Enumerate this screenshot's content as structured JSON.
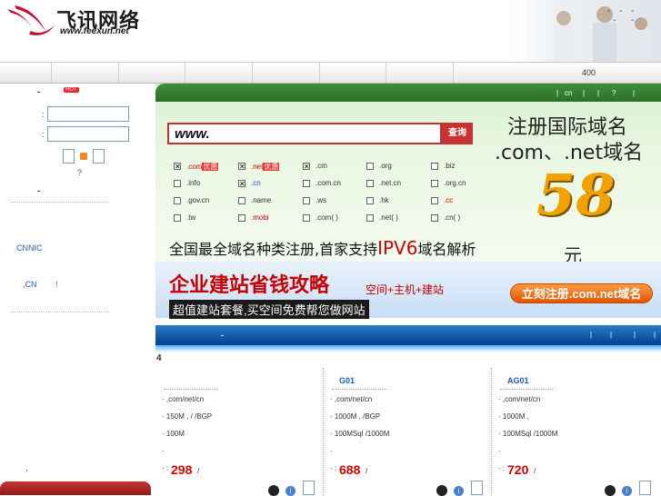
{
  "logo": {
    "name_cn": "飞讯网络",
    "url": "www.feexun.net"
  },
  "nav": {
    "phone_prefix": "400"
  },
  "sidebar": {
    "hot_label": "HOT",
    "field1_colon": ":",
    "field2_colon": ":",
    "help_mark": "?",
    "cnnic": "CNNIC",
    "cn_notice": ",CN",
    "exclaim": "!",
    "dash1": "-",
    "dash2": "-",
    "comma": ","
  },
  "banner": {
    "top_links": [
      "cn",
      "?"
    ],
    "search_prefix": "www.",
    "search_button": "查询",
    "domains": [
      {
        "label": ".com",
        "hot": "优惠",
        "checked": true,
        "red": true
      },
      {
        "label": ".net",
        "hot": "优惠",
        "checked": true,
        "red": true
      },
      {
        "label": ".cm",
        "checked": true
      },
      {
        "label": ".org",
        "checked": false
      },
      {
        "label": ".biz",
        "checked": false
      },
      {
        "label": ".info",
        "checked": false
      },
      {
        "label": ".cn",
        "checked": true,
        "blue": true
      },
      {
        "label": ".com.cn",
        "checked": false
      },
      {
        "label": ".net.cn",
        "checked": false
      },
      {
        "label": ".org.cn",
        "checked": false
      },
      {
        "label": ".gov.cn",
        "checked": false
      },
      {
        "label": ".name",
        "checked": false
      },
      {
        "label": ".ws",
        "checked": false
      },
      {
        "label": ".hk",
        "checked": false
      },
      {
        "label": ".cc",
        "checked": false,
        "red": true
      },
      {
        "label": ".tw",
        "checked": false
      },
      {
        "label": ".mobi",
        "checked": false,
        "red": true
      },
      {
        "label": ".com( )",
        "checked": false
      },
      {
        "label": ".net( )",
        "checked": false
      },
      {
        "label": ".cn( )",
        "checked": false
      }
    ],
    "promo_line1": "注册国际域名",
    "promo_line2": ".com、.net域名",
    "price": "58",
    "unit": "元",
    "slogan_a": "全国最全域名种类注册,首家支持",
    "slogan_ipv6": "IPV6",
    "slogan_b": "域名解析"
  },
  "ad2": {
    "title": "企业建站省钱攻略",
    "subtitle": "空间+主机+建站",
    "band": "超值建站套餐,买空间免费帮您做网站",
    "button": "立刻注册.com.net域名"
  },
  "bluebar": {
    "dash": "-",
    "number": "4"
  },
  "products": [
    {
      "name": "",
      "lines": [
        ",com/net/cn",
        "150M ,  / /BGP",
        "100M",
        "",
        ":"
      ],
      "price": "298",
      "slash": "/"
    },
    {
      "name": "G01",
      "lines": [
        ",com/net/cn",
        "1000M ,  /BGP",
        "100MSql  /1000M",
        "",
        ":"
      ],
      "price": "688",
      "slash": "/"
    },
    {
      "name": "AG01",
      "lines": [
        ",com/net/cn",
        "1000M  ,",
        "100MSql  /1000M",
        "",
        ":"
      ],
      "price": "720",
      "slash": "/"
    }
  ],
  "colors": {
    "accent_red": "#c83232",
    "banner_green": "#2f6f2c",
    "blue_bar": "#0b4d9a",
    "price_gold": "#f2a200"
  },
  "icons": [
    "logo-bird-icon",
    "qq-icon",
    "info-icon",
    "rss-icon"
  ]
}
